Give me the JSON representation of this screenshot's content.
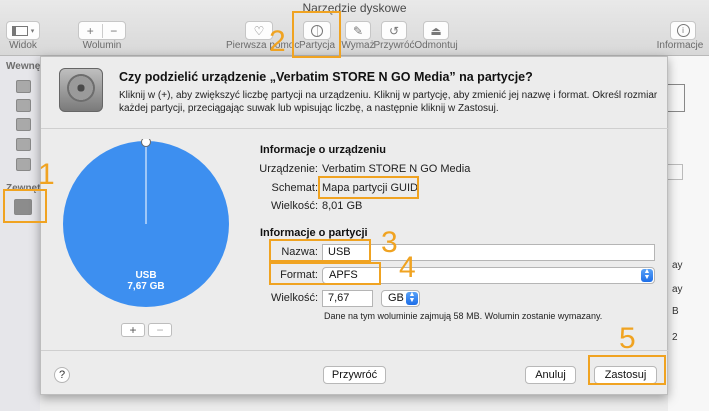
{
  "window": {
    "title": "Narzędzie dyskowe"
  },
  "toolbar": {
    "view_label": "Widok",
    "volume_label": "Wolumin",
    "first_aid_label": "Pierwsza pomoc",
    "partition_label": "Partycja",
    "erase_label": "Wymaż",
    "restore_label": "Przywróć",
    "unmount_label": "Odmontuj",
    "info_label": "Informacje"
  },
  "sidebar": {
    "internal_header": "Wewnę",
    "external_header": "Zewnęt"
  },
  "sheet": {
    "title": "Czy podzielić urządzenie „Verbatim STORE N GO Media” na partycje?",
    "description": "Kliknij w (+), aby zwiększyć liczbę partycji na urządzeniu. Kliknij w partycję, aby zmienić jej nazwę i format. Określ rozmiar każdej partycji, przeciągając suwak lub wpisując liczbę, a następnie kliknij w Zastosuj.",
    "pie": {
      "name": "USB",
      "size": "7,67 GB",
      "color": "#3d8ff0"
    },
    "device_info": {
      "title": "Informacje o urządzeniu",
      "device_label": "Urządzenie:",
      "device_value": "Verbatim STORE N GO Media",
      "scheme_label": "Schemat:",
      "scheme_value": "Mapa partycji GUID",
      "size_label": "Wielkość:",
      "size_value": "8,01 GB"
    },
    "partition_info": {
      "title": "Informacje o partycji",
      "name_label": "Nazwa:",
      "name_value": "USB",
      "format_label": "Format:",
      "format_value": "APFS",
      "size_label": "Wielkość:",
      "size_value": "7,67",
      "unit_value": "GB",
      "note": "Dane na tym woluminie zajmują 58 MB. Wolumin zostanie wymazany."
    },
    "buttons": {
      "add": "+",
      "remove": "−",
      "help": "?",
      "revert": "Przywróć",
      "cancel": "Anuluj",
      "apply": "Zastosuj"
    }
  },
  "background_right": [
    "ay",
    "ay",
    "B",
    "2"
  ],
  "annotations": {
    "color": "#f0a321",
    "labels": [
      "1",
      "2",
      "3",
      "4",
      "5"
    ]
  }
}
